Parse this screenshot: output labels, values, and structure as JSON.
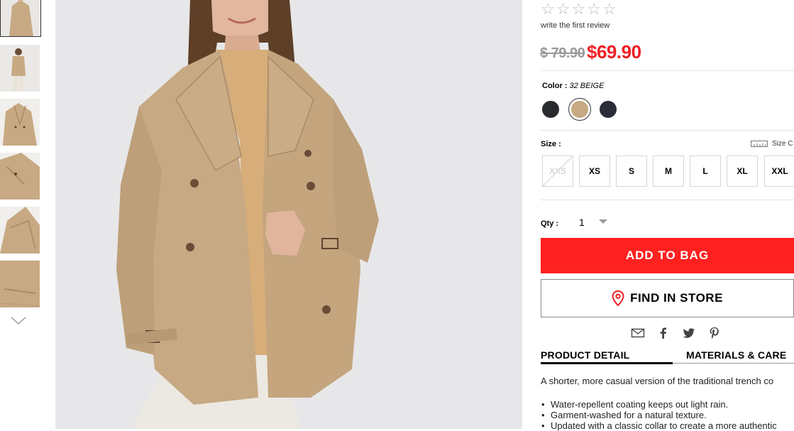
{
  "review": {
    "link": "write the first review",
    "stars": 5
  },
  "price": {
    "original": "$ 79.90",
    "sale": "$69.90"
  },
  "color": {
    "label": "Color :",
    "selected": "32 BEIGE",
    "swatches": [
      "#2a2b2e",
      "#c7a983",
      "#2a2c3a"
    ]
  },
  "size": {
    "label": "Size :",
    "chart_label": "Size C",
    "options": [
      "XXS",
      "XS",
      "S",
      "M",
      "L",
      "XL",
      "XXL"
    ],
    "unavailable": [
      "XXS"
    ]
  },
  "qty": {
    "label": "Qty :",
    "value": "1"
  },
  "buttons": {
    "add_to_bag": "ADD TO BAG",
    "find_in_store": "FIND IN STORE"
  },
  "share_icons": [
    "email-icon",
    "facebook-icon",
    "twitter-icon",
    "pinterest-icon"
  ],
  "tabs": [
    "PRODUCT DETAIL",
    "MATERIALS & CARE"
  ],
  "details": {
    "intro": "A shorter, more casual version of the traditional trench co",
    "bullets": [
      "Water-repellent coating keeps out light rain.",
      "Garment-washed for a natural texture.",
      "Updated with a classic collar to create a more authentic"
    ]
  },
  "colors": {
    "accent": "#ff2020",
    "sale_price": "#ee2024",
    "coat": "#c7a983"
  }
}
